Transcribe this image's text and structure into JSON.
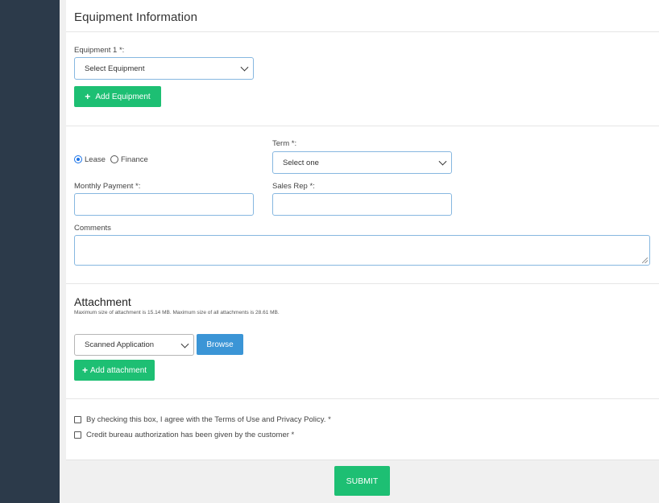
{
  "equipment_section": {
    "title": "Equipment Information",
    "equipment1_label": "Equipment 1 *:",
    "equipment1_value": "Select Equipment",
    "add_equipment_label": "Add Equipment"
  },
  "financing": {
    "lease_label": "Lease",
    "finance_label": "Finance",
    "selected": "Lease",
    "term_label": "Term *:",
    "term_value": "Select one",
    "monthly_payment_label": "Monthly Payment *:",
    "monthly_payment_value": "",
    "sales_rep_label": "Sales Rep *:",
    "sales_rep_value": "",
    "comments_label": "Comments",
    "comments_value": ""
  },
  "attachment": {
    "title": "Attachment",
    "note": "Maximum size of attachment is 15.14 MB. Maximum size of all attachments is 28.61 MB.",
    "type_value": "Scanned Application",
    "browse_label": "Browse",
    "add_attachment_label": "Add attachment"
  },
  "agreements": {
    "terms_label": "By checking this box, I agree with the Terms of Use and Privacy Policy. *",
    "credit_label": "Credit bureau authorization has been given by the customer *"
  },
  "footer": {
    "submit_label": "SUBMIT"
  },
  "colors": {
    "sidebar": "#2c3a4a",
    "green": "#1dbf73",
    "blue": "#3b95d6",
    "input_border": "#86b7e0"
  }
}
